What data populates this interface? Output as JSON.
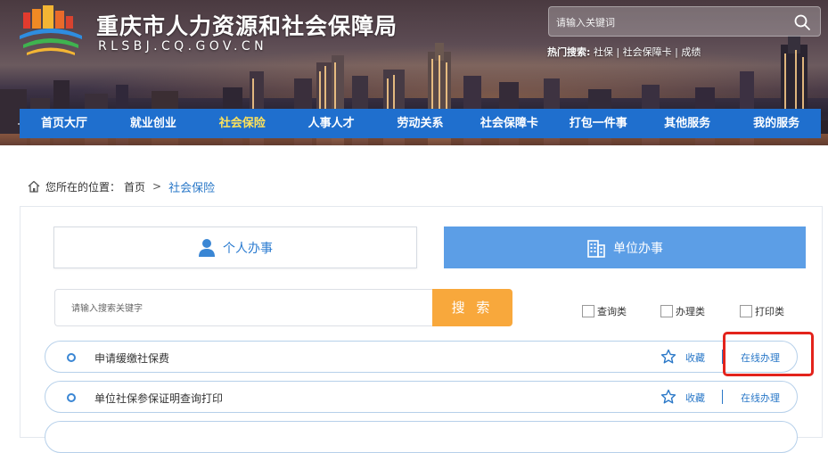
{
  "header": {
    "site_title": "重庆市人力资源和社会保障局",
    "site_domain": "RLSBJ.CQ.GOV.CN",
    "search_placeholder": "请输入关键词",
    "hot_search_label": "热门搜索:",
    "hot_search_items": [
      "社保",
      "社会保障卡",
      "成绩"
    ],
    "hot_search_separator": "|"
  },
  "nav": {
    "items": [
      {
        "label": "首页大厅"
      },
      {
        "label": "就业创业"
      },
      {
        "label": "社会保险"
      },
      {
        "label": "人事人才"
      },
      {
        "label": "劳动关系"
      },
      {
        "label": "社会保障卡"
      },
      {
        "label": "打包一件事"
      },
      {
        "label": "其他服务"
      },
      {
        "label": "我的服务"
      }
    ],
    "active_index": 2,
    "active_color": "#ffe25a",
    "bar_color": "#1f6fce"
  },
  "breadcrumb": {
    "prefix": "您所在的位置：",
    "home": "首页",
    "separator": ">",
    "current": "社会保险"
  },
  "tabs": {
    "personal": "个人办事",
    "unit": "单位办事",
    "active": "unit"
  },
  "search": {
    "placeholder": "请输入搜索关键字",
    "button": "搜 索"
  },
  "filters": [
    {
      "label": "查询类",
      "checked": false
    },
    {
      "label": "办理类",
      "checked": false
    },
    {
      "label": "打印类",
      "checked": false
    }
  ],
  "services": [
    {
      "title": "申请缓缴社保费",
      "favorite": "收藏",
      "action": "在线办理"
    },
    {
      "title": "单位社保参保证明查询打印",
      "favorite": "收藏",
      "action": "在线办理"
    }
  ],
  "colors": {
    "link_blue": "#2a78c8",
    "search_button": "#f8a83c",
    "unit_tab": "#5c9ee6",
    "highlight": "#e3231c"
  },
  "icons": {
    "logo": "government-building-logo",
    "search": "search-icon",
    "home": "home-icon",
    "person": "person-icon",
    "building": "building-icon",
    "star": "star-icon"
  }
}
